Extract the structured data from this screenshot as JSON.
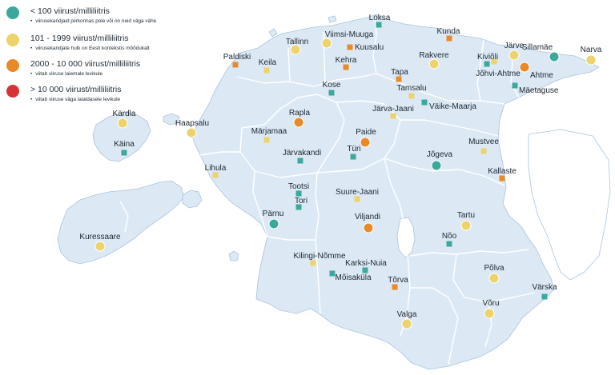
{
  "colors": {
    "water": "#ffffff",
    "land": "#dce9f5",
    "border": "#ffffff",
    "coast": "#a9c4dd",
    "cat1": "#3aa99c",
    "cat2": "#ecd36b",
    "cat3": "#e88a2a",
    "cat4": "#d63238"
  },
  "legend": [
    {
      "id": "cat1",
      "title": "< 100 viirust/milliliitris",
      "note": "viirusekandjaid piirkonnas pole või on neid väga vähe"
    },
    {
      "id": "cat2",
      "title": "101 - 1999 viirust/milliliitris",
      "note": "viirusekandjate hulk on Eesti kontekstis mõõdukalt"
    },
    {
      "id": "cat3",
      "title": "2000 - 10 000 viirust/milliliitris",
      "note": "viitab viiruse laiemale levikule"
    },
    {
      "id": "cat4",
      "title": "> 10 000 viirust/milliliitris",
      "note": "viitab viiruse väga laialdasele levikule"
    }
  ],
  "cities": [
    {
      "name": "Loksa",
      "cat": "cat1",
      "marker": "square"
    },
    {
      "name": "Kunda",
      "cat": "cat3",
      "marker": "square"
    },
    {
      "name": "Tallinn",
      "cat": "cat2",
      "marker": "circle"
    },
    {
      "name": "Viimsi-Muuga",
      "cat": "cat2",
      "marker": "circle"
    },
    {
      "name": "Kuusalu",
      "cat": "cat3",
      "marker": "square"
    },
    {
      "name": "Paldiski",
      "cat": "cat3",
      "marker": "square"
    },
    {
      "name": "Keila",
      "cat": "cat2",
      "marker": "square"
    },
    {
      "name": "Kehra",
      "cat": "cat3",
      "marker": "square"
    },
    {
      "name": "Rakvere",
      "cat": "cat2",
      "marker": "circle"
    },
    {
      "name": "Kiviõli",
      "cat": "cat2",
      "marker": "square"
    },
    {
      "name": "Järve",
      "cat": "cat2",
      "marker": "circle"
    },
    {
      "name": "Sillamäe",
      "cat": "cat1",
      "marker": "circle"
    },
    {
      "name": "Narva",
      "cat": "cat2",
      "marker": "circle"
    },
    {
      "name": "Jõhvi-Ahtme",
      "cat": "cat1",
      "marker": "square"
    },
    {
      "name": "Ahtme",
      "cat": "cat3",
      "marker": "circle"
    },
    {
      "name": "Mäetaguse",
      "cat": "cat1",
      "marker": "square"
    },
    {
      "name": "Tapa",
      "cat": "cat3",
      "marker": "square"
    },
    {
      "name": "Tamsalu",
      "cat": "cat2",
      "marker": "square"
    },
    {
      "name": "Väike-Maarja",
      "cat": "cat1",
      "marker": "square"
    },
    {
      "name": "Kose",
      "cat": "cat1",
      "marker": "square"
    },
    {
      "name": "Järva-Jaani",
      "cat": "cat2",
      "marker": "square"
    },
    {
      "name": "Kärdla",
      "cat": "cat2",
      "marker": "circle"
    },
    {
      "name": "Rapla",
      "cat": "cat3",
      "marker": "circle"
    },
    {
      "name": "Haapsalu",
      "cat": "cat2",
      "marker": "circle"
    },
    {
      "name": "Märjamaa",
      "cat": "cat2",
      "marker": "square"
    },
    {
      "name": "Paide",
      "cat": "cat3",
      "marker": "circle"
    },
    {
      "name": "Käina",
      "cat": "cat1",
      "marker": "square"
    },
    {
      "name": "Türi",
      "cat": "cat1",
      "marker": "square"
    },
    {
      "name": "Järvakandi",
      "cat": "cat1",
      "marker": "square"
    },
    {
      "name": "Mustvee",
      "cat": "cat2",
      "marker": "square"
    },
    {
      "name": "Jõgeva",
      "cat": "cat1",
      "marker": "circle"
    },
    {
      "name": "Lihula",
      "cat": "cat2",
      "marker": "square"
    },
    {
      "name": "Kallaste",
      "cat": "cat3",
      "marker": "square"
    },
    {
      "name": "Tootsi",
      "cat": "cat1",
      "marker": "square"
    },
    {
      "name": "Suure-Jaani",
      "cat": "cat2",
      "marker": "square"
    },
    {
      "name": "Tori",
      "cat": "cat1",
      "marker": "square"
    },
    {
      "name": "Pärnu",
      "cat": "cat1",
      "marker": "circle"
    },
    {
      "name": "Viljandi",
      "cat": "cat3",
      "marker": "circle"
    },
    {
      "name": "Tartu",
      "cat": "cat2",
      "marker": "circle"
    },
    {
      "name": "Nõo",
      "cat": "cat1",
      "marker": "square"
    },
    {
      "name": "Kuressaare",
      "cat": "cat2",
      "marker": "circle"
    },
    {
      "name": "Kilingi-Nõmme",
      "cat": "cat2",
      "marker": "square"
    },
    {
      "name": "Karksi-Nuia",
      "cat": "cat1",
      "marker": "square"
    },
    {
      "name": "Mõisaküla",
      "cat": "cat1",
      "marker": "square"
    },
    {
      "name": "Põlva",
      "cat": "cat2",
      "marker": "circle"
    },
    {
      "name": "Tõrva",
      "cat": "cat3",
      "marker": "square"
    },
    {
      "name": "Värska",
      "cat": "cat1",
      "marker": "square"
    },
    {
      "name": "Võru",
      "cat": "cat2",
      "marker": "circle"
    },
    {
      "name": "Valga",
      "cat": "cat2",
      "marker": "circle"
    }
  ]
}
